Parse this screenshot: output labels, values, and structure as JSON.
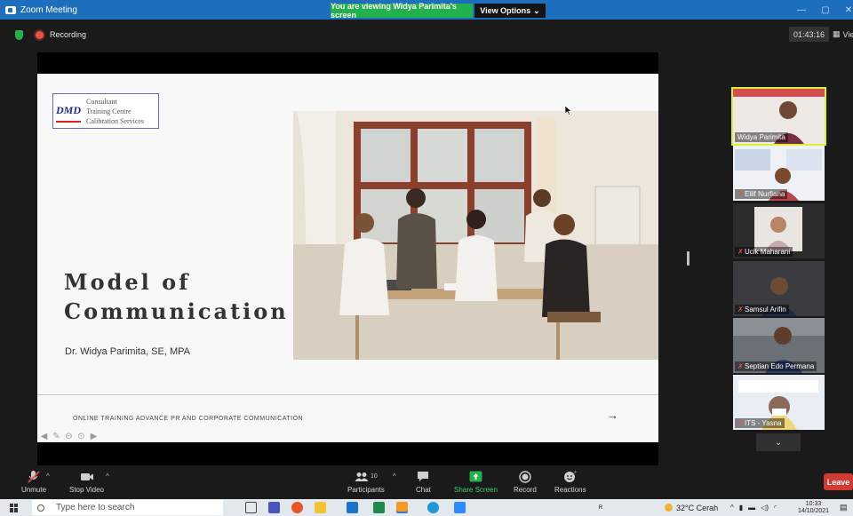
{
  "window": {
    "title": "Zoom Meeting",
    "viewing_banner": "You are viewing Widya Parimita's screen",
    "view_options": "View Options",
    "minimize_icon": "minimize-icon",
    "maximize_icon": "maximize-icon",
    "close_icon": "close-icon"
  },
  "status": {
    "recording_label": "Recording",
    "timer": "01:43:16",
    "view_label": "View"
  },
  "slide": {
    "logo_mark": "DMD",
    "logo_lines": [
      "Consultant",
      "Training Centre",
      "Calibration Services"
    ],
    "title_line1": "Model of",
    "title_line2": "Communication",
    "author": "Dr. Widya Parimita, SE, MPA",
    "footer": "ONLINE TRAINING ADVANCE PR AND CORPORATE COMMUNICATION",
    "arrow": "→"
  },
  "gallery": [
    {
      "name": "Widya Parimita",
      "muted": false,
      "active": true
    },
    {
      "name": "Ellif Nurfiana",
      "muted": true,
      "active": false
    },
    {
      "name": "Ucik Maharani",
      "muted": true,
      "active": false
    },
    {
      "name": "Samsul Arifin",
      "muted": true,
      "active": false
    },
    {
      "name": "Septian Edo Permana",
      "muted": true,
      "active": false
    },
    {
      "name": "ITS - Yasna",
      "muted": true,
      "active": false
    }
  ],
  "toolbar": {
    "unmute": "Unmute",
    "stop_video": "Stop Video",
    "participants": "Participants",
    "participants_count": "10",
    "chat": "Chat",
    "share_screen": "Share Screen",
    "record": "Record",
    "reactions": "Reactions",
    "leave": "Leave"
  },
  "taskbar": {
    "search_placeholder": "Type here to search",
    "weather": "32°C Cerah",
    "time": "10:33",
    "date": "14/10/2021"
  },
  "colors": {
    "zoom_blue": "#1d6fbd",
    "banner_green": "#23b14d",
    "active_speaker": "#d8ef3c",
    "leave_red": "#d43a34"
  }
}
